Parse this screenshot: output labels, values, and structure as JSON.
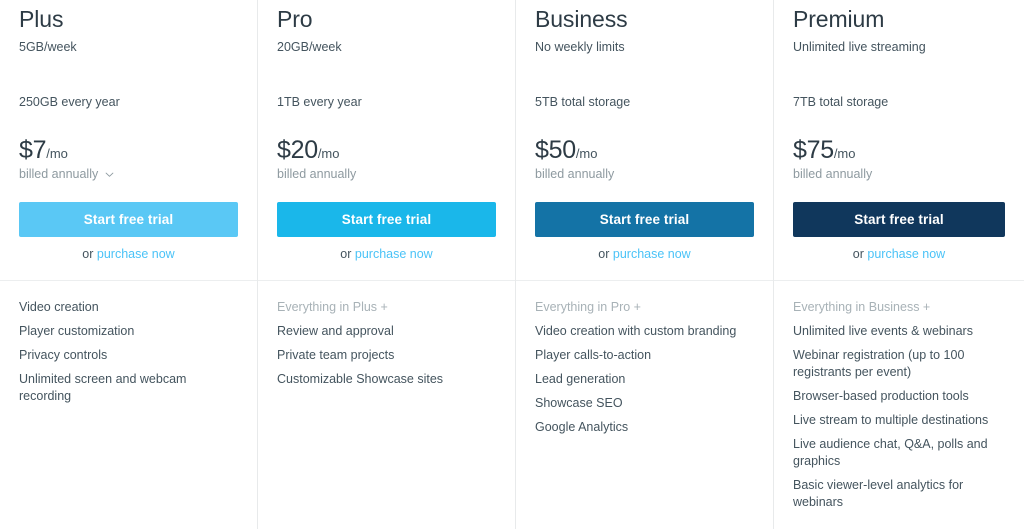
{
  "plans": [
    {
      "name": "Plus",
      "tagline": "5GB/week",
      "storage": "250GB every year",
      "price": "$7",
      "period": "/mo",
      "billing": "billed annually",
      "has_billing_chevron": true,
      "cta_label": "Start free trial",
      "purchase_prefix": "or ",
      "purchase_label": "purchase now",
      "button_color": "#5ac8f5",
      "features": [
        {
          "text": "Video creation",
          "muted": false
        },
        {
          "text": "Player customization",
          "muted": false
        },
        {
          "text": "Privacy controls",
          "muted": false
        },
        {
          "text": "Unlimited screen and webcam recording",
          "muted": false
        }
      ]
    },
    {
      "name": "Pro",
      "tagline": "20GB/week",
      "storage": "1TB every year",
      "price": "$20",
      "period": "/mo",
      "billing": "billed annually",
      "has_billing_chevron": false,
      "cta_label": "Start free trial",
      "purchase_prefix": "or ",
      "purchase_label": "purchase now",
      "button_color": "#1ab7ea",
      "features": [
        {
          "text": "Everything in Plus +",
          "muted": true
        },
        {
          "text": "Review and approval",
          "muted": false
        },
        {
          "text": "Private team projects",
          "muted": false
        },
        {
          "text": "Customizable Showcase sites",
          "muted": false
        }
      ]
    },
    {
      "name": "Business",
      "tagline": "No weekly limits",
      "storage": "5TB total storage",
      "price": "$50",
      "period": "/mo",
      "billing": "billed annually",
      "has_billing_chevron": false,
      "cta_label": "Start free trial",
      "purchase_prefix": "or ",
      "purchase_label": "purchase now",
      "button_color": "#1473a6",
      "features": [
        {
          "text": "Everything in Pro +",
          "muted": true
        },
        {
          "text": "Video creation with custom branding",
          "muted": false
        },
        {
          "text": "Player calls-to-action",
          "muted": false
        },
        {
          "text": "Lead generation",
          "muted": false
        },
        {
          "text": "Showcase SEO",
          "muted": false
        },
        {
          "text": "Google Analytics",
          "muted": false
        }
      ]
    },
    {
      "name": "Premium",
      "tagline": "Unlimited live streaming",
      "storage": "7TB total storage",
      "price": "$75",
      "period": "/mo",
      "billing": "billed annually",
      "has_billing_chevron": false,
      "cta_label": "Start free trial",
      "purchase_prefix": "or ",
      "purchase_label": "purchase now",
      "button_color": "#10375c",
      "features": [
        {
          "text": "Everything in Business +",
          "muted": true
        },
        {
          "text": "Unlimited live events & webinars",
          "muted": false
        },
        {
          "text": "Webinar registration (up to 100 registrants per event)",
          "muted": false
        },
        {
          "text": "Browser-based production tools",
          "muted": false
        },
        {
          "text": "Live stream to multiple destinations",
          "muted": false
        },
        {
          "text": "Live audience chat, Q&A, polls and graphics",
          "muted": false
        },
        {
          "text": "Basic viewer-level analytics for webinars",
          "muted": false
        }
      ]
    }
  ],
  "colors": {
    "link": "#4bc3f7",
    "title": "#2d3b45",
    "body_text": "#44545e",
    "muted_text": "#a8b2b7",
    "divider": "#e8eaeb"
  }
}
